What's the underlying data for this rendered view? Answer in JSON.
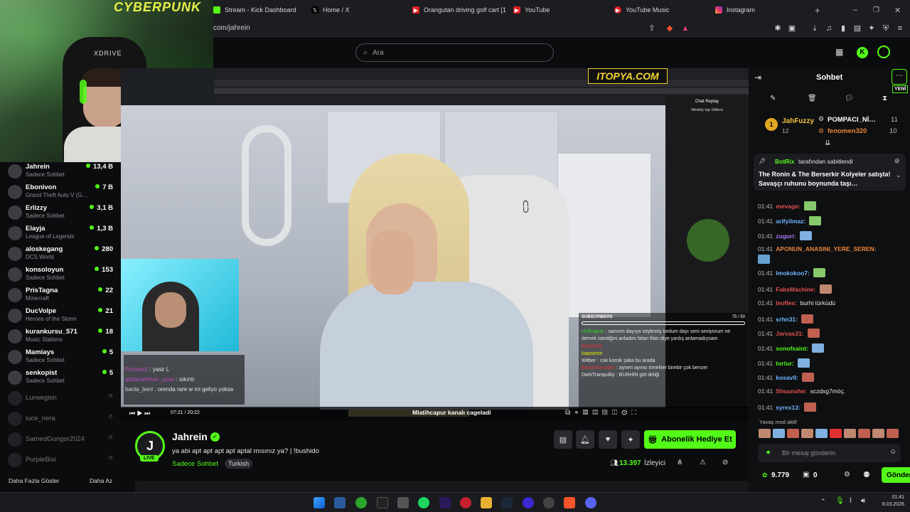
{
  "browser": {
    "tabs": [
      {
        "label": "Stream - Kick Dashboard",
        "icon": "kick-icon"
      },
      {
        "label": "Home / X",
        "icon": "x-icon"
      },
      {
        "label": "Orangutan driving golf cart [10…",
        "icon": "youtube-icon"
      },
      {
        "label": "YouTube",
        "icon": "youtube-icon"
      },
      {
        "label": "YouTube Music",
        "icon": "youtube-music-icon"
      },
      {
        "label": "Instagram",
        "icon": "instagram-icon"
      }
    ],
    "address": "com/jahrein"
  },
  "header": {
    "search_placeholder": "Ara"
  },
  "webcam": {
    "brand": "XDRIVE",
    "poster": "CYBERPUNK"
  },
  "sidebar": {
    "channels": [
      {
        "name": "Jahrein",
        "category": "Sadece Sohbet",
        "viewers": "13,4 B",
        "live": true
      },
      {
        "name": "Ebonivon",
        "category": "Grand Theft Auto V (G…",
        "viewers": "7 B",
        "live": true
      },
      {
        "name": "Erlizzy",
        "category": "Sadece Sohbet",
        "viewers": "3,1 B",
        "live": true
      },
      {
        "name": "Elayja",
        "category": "League of Legends",
        "viewers": "1,3 B",
        "live": true
      },
      {
        "name": "aloskegang",
        "category": "DCS World",
        "viewers": "280",
        "live": true
      },
      {
        "name": "konsoloyun",
        "category": "Sadece Sohbet",
        "viewers": "153",
        "live": true
      },
      {
        "name": "PrisTagna",
        "category": "Minecraft",
        "viewers": "22",
        "live": true
      },
      {
        "name": "DucVolpe",
        "category": "Heroes of the Storm",
        "viewers": "21",
        "live": true
      },
      {
        "name": "kurankursu_571",
        "category": "Music Stations",
        "viewers": "18",
        "live": true
      },
      {
        "name": "Mamiays",
        "category": "Sadece Sohbet",
        "viewers": "5",
        "live": true
      },
      {
        "name": "senkopist",
        "category": "Sadece Sohbet",
        "viewers": "5",
        "live": true
      },
      {
        "name": "Lurwegion",
        "category": "",
        "viewers": "",
        "live": false
      },
      {
        "name": "luce_nera",
        "category": "",
        "viewers": "",
        "live": false
      },
      {
        "name": "SamedGungor2024",
        "category": "",
        "viewers": "",
        "live": false
      },
      {
        "name": "PurpleBixi",
        "category": "",
        "viewers": "",
        "live": false
      }
    ],
    "show_more": "Daha Fazla Göster",
    "show_less": "Daha Az"
  },
  "player": {
    "overlay_logo": "ITOPYA.COM",
    "inner_chat_title": "Chat Replay",
    "inner_gifters": "Weekly top Gifters",
    "subscribers_label": "SUBSCRIBERS",
    "sub_count": "75 / 50",
    "caption": "Mlatihcapur kanalı cageladi",
    "inner_time": "07:21 / 20:22",
    "left_chat": [
      {
        "user": "Pozilaw2",
        "text": "yasir L",
        "color": "#c04ac0"
      },
      {
        "user": "abdurrahman_uzun",
        "text": "sıkıntı",
        "color": "#c04ac0"
      },
      {
        "user": "banla_beni",
        "text": "orenda rare w mi geliyo yoksa",
        "color": "#d0d0d0"
      }
    ],
    "right_chat": [
      {
        "user": "chillingear",
        "text": "sanırım dayıya söylemiş lordum dayı seni seviyorum ne demek istediğini anladım falan filan diye yanlış anlamadıysam",
        "color": "#2bd92b"
      },
      {
        "user": "Bilal6543",
        "text": "",
        "color": "#d33"
      },
      {
        "user": "kapoartor",
        "text": "",
        "color": "#e6e600"
      },
      {
        "user": "Witber",
        "text": "cok komik şaka bu arada",
        "color": "#dddddd"
      },
      {
        "user": "BenimKemalim",
        "text": "aynen aynısı örnekler birebir çok benzer",
        "color": "#d33"
      },
      {
        "user": "DarkTranquility",
        "text": "BURHİN göt deliği",
        "color": "#dddddd"
      }
    ]
  },
  "stream": {
    "streamer": "Jahrein",
    "title": "ya abi apt apt apt apt aptal mısınız ya? | !bushido",
    "category": "Sadece Sohbet",
    "tag": "Turkish",
    "viewers": "13.397",
    "viewers_label": "İzleyici",
    "live_badge": "LIVE",
    "gift_button": "Abonelik Hediye Et"
  },
  "chat": {
    "title": "Sohbet",
    "new_badge": "YENİ",
    "top_gifters": [
      {
        "rank": "1",
        "name": "JahFuzzy",
        "count": "12"
      },
      {
        "name": "POMPACI_Nİ…",
        "count": "11"
      },
      {
        "name": "fenomen320",
        "count": "10"
      }
    ],
    "pinned_by": "BotRix",
    "pinned_suffix": "tarafından sabitlendi",
    "pinned_text": "The Ronin & The Berserkir Kolyeler satışta! Savaşçı ruhunu boynunda taşı…",
    "messages": [
      {
        "time": "01:41",
        "user": "mevage:",
        "text": "",
        "color": "#e05050",
        "emote": "#86c86b"
      },
      {
        "time": "01:41",
        "user": "arifyilmaz:",
        "text": "",
        "color": "#6fb4ff",
        "emote": "#86c86b"
      },
      {
        "time": "01:41",
        "user": "zuguri:",
        "text": "",
        "color": "#a47cf0",
        "emote": "#7fb0e0"
      },
      {
        "time": "01:41",
        "user": "APONUN_ANASINI_YERE_SEREN:",
        "text": "",
        "color": "#e8853a",
        "emote": "#66a0d0"
      },
      {
        "time": "01:41",
        "user": "lmokokoo7:",
        "text": "",
        "color": "#6fb4ff",
        "emote": "#86c86b"
      },
      {
        "time": "01:41",
        "user": "FaksMachine:",
        "text": "",
        "color": "#e05050",
        "emote": "#c08870"
      },
      {
        "time": "01:41",
        "user": "leofles:",
        "text": "burhi türküdü",
        "color": "#e05050",
        "emote": ""
      },
      {
        "time": "01:41",
        "user": "srhn31:",
        "text": "",
        "color": "#6fb4ff",
        "emote": "#c06050"
      },
      {
        "time": "01:41",
        "user": "Jarvas31:",
        "text": "",
        "color": "#e05050",
        "emote": "#c06050"
      },
      {
        "time": "01:41",
        "user": "sonofsaint:",
        "text": "",
        "color": "#53fc18",
        "emote": "#7fb0e0"
      },
      {
        "time": "01:41",
        "user": "tortur:",
        "text": "",
        "color": "#53fc18",
        "emote": "#7fb0e0"
      },
      {
        "time": "01:41",
        "user": "kosav9:",
        "text": "",
        "color": "#6fb4ff",
        "emote": "#c06050"
      },
      {
        "time": "01:41",
        "user": "Shuunahe:",
        "text": "sczdxg7möç.",
        "color": "#e05050",
        "emote": ""
      },
      {
        "time": "01:41",
        "user": "syrex13:",
        "text": "",
        "color": "#6fb4ff",
        "emote": "#c06050"
      }
    ],
    "slow_mode": "Yavaş mod aktif",
    "input_placeholder": "Bir mesaj gönderin",
    "points": "9.779",
    "zero": "0",
    "send": "Gönder"
  },
  "taskbar": {
    "time": "01:41",
    "date": "8.03.2026"
  },
  "colors": {
    "accent": "#53fc18",
    "bg": "#0b0c0e",
    "panel": "#0e0f11"
  }
}
